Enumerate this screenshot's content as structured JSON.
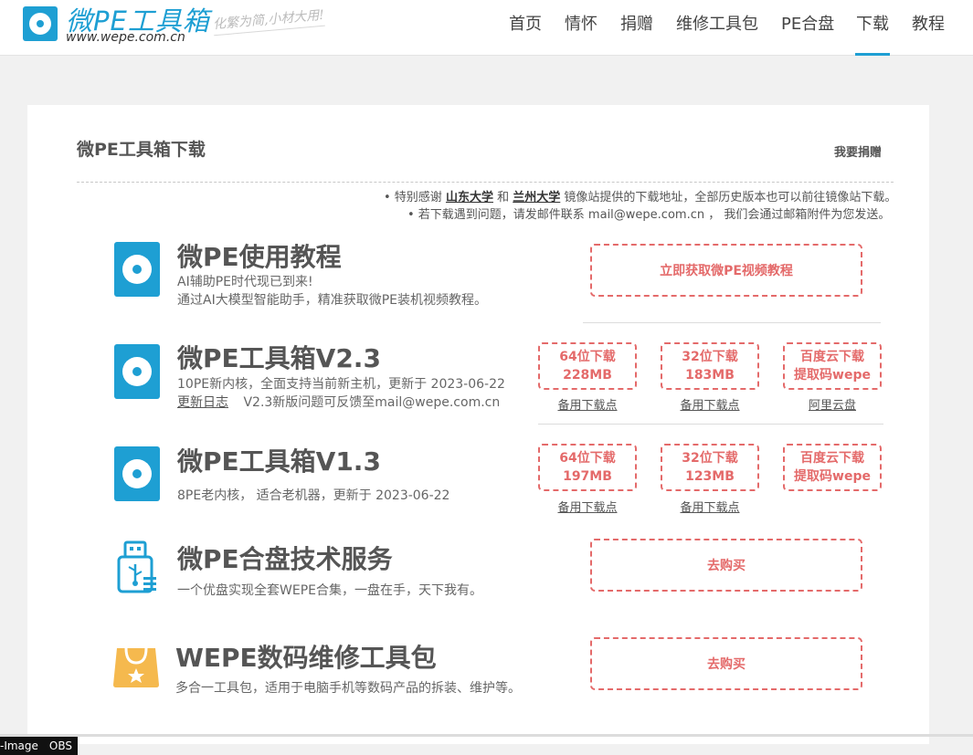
{
  "header": {
    "logo_title": "微PE工具箱",
    "logo_url": "www.wepe.com.cn",
    "slogan": "化繁为简,小材大用!",
    "nav": [
      {
        "label": "首页"
      },
      {
        "label": "情怀"
      },
      {
        "label": "捐赠"
      },
      {
        "label": "维修工具包"
      },
      {
        "label": "PE合盘"
      },
      {
        "label": "下载",
        "active": true
      },
      {
        "label": "教程"
      }
    ]
  },
  "page": {
    "title": "微PE工具箱下载",
    "donate_label": "我要捐赠",
    "notes": {
      "n1_prefix": "• 特别感谢",
      "n1_sdu": "山东大学",
      "n1_and": "和",
      "n1_lzu": "兰州大学",
      "n1_suffix": "镜像站提供的下载地址，全部历史版本也可以前往镜像站下载。",
      "n2": "• 若下载遇到问题，请发邮件联系 mail@wepe.com.cn ， 我们会通过邮箱附件为您发送。"
    }
  },
  "items": {
    "tutorial": {
      "title": "微PE使用教程",
      "desc1": "AI辅助PE时代现已到来!",
      "desc2": "通过AI大模型智能助手，精准获取微PE装机视频教程。",
      "button": "立即获取微PE视频教程"
    },
    "v23": {
      "title": "微PE工具箱V2.3",
      "desc1": "10PE新内核，全面支持当前新主机，更新于 2023-06-22",
      "changelog": "更新日志",
      "desc2": "V2.3新版问题可反馈至mail@wepe.com.cn",
      "btn64_l1": "64位下载",
      "btn64_l2": "228MB",
      "btn32_l1": "32位下载",
      "btn32_l2": "183MB",
      "btnbd_l1": "百度云下载",
      "btnbd_l2": "提取码wepe",
      "alt64": "备用下载点",
      "alt32": "备用下载点",
      "altbd": "阿里云盘"
    },
    "v13": {
      "title": "微PE工具箱V1.3",
      "desc1": "8PE老内核， 适合老机器，更新于 2023-06-22",
      "btn64_l1": "64位下载",
      "btn64_l2": "197MB",
      "btn32_l1": "32位下载",
      "btn32_l2": "123MB",
      "btnbd_l1": "百度云下载",
      "btnbd_l2": "提取码wepe",
      "alt64": "备用下载点",
      "alt32": "备用下载点"
    },
    "hepan": {
      "title": "微PE合盘技术服务",
      "desc1": "一个优盘实现全套WEPE合集，一盘在手，天下我有。",
      "button": "去购买"
    },
    "repair": {
      "title": "WEPE数码维修工具包",
      "desc1": "多合一工具包，适用于电脑手机等数码产品的拆装、维护等。",
      "button": "去购买"
    }
  },
  "taskbar": {
    "item1": "-Image",
    "item2": "OBS"
  },
  "colors": {
    "brand_blue": "#1e9fd3",
    "button_red": "#e46a6a",
    "bag_yellow": "#f5b94e"
  }
}
